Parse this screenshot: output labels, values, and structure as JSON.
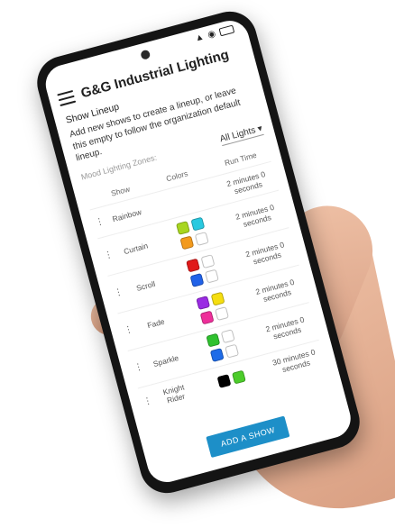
{
  "status": {
    "icons": "▲ ◉"
  },
  "app": {
    "title": "G&G Industrial Lighting"
  },
  "page": {
    "section_title": "Show Lineup",
    "description": "Add new shows to create a lineup, or leave this empty to follow the organization default lineup.",
    "zones_label": "Mood Lighting Zones:",
    "zones_select": "All Lights ▾"
  },
  "table": {
    "headers": {
      "show": "Show",
      "colors": "Colors",
      "runtime": "Run Time"
    },
    "rows": [
      {
        "name": "Rainbow",
        "colors": [],
        "runtime": "2 minutes 0 seconds"
      },
      {
        "name": "Curtain",
        "colors": [
          "#a8d620",
          "#28c9e0",
          "#f39a1d",
          "#ffffff"
        ],
        "runtime": "2 minutes 0 seconds"
      },
      {
        "name": "Scroll",
        "colors": [
          "#e01a1a",
          "#ffffff",
          "#2162e8",
          "#ffffff"
        ],
        "runtime": "2 minutes 0 seconds"
      },
      {
        "name": "Fade",
        "colors": [
          "#9a2be3",
          "#f5de10",
          "#ee2f9a",
          "#ffffff"
        ],
        "runtime": "2 minutes 0 seconds"
      },
      {
        "name": "Sparkle",
        "colors": [
          "#2fc12f",
          "#ffffff",
          "#1e6be8",
          "#ffffff"
        ],
        "runtime": "2 minutes 0 seconds"
      },
      {
        "name": "Knight Rider",
        "colors": [
          "#000000",
          "#4ccc2a"
        ],
        "runtime": "30 minutes 0 seconds"
      }
    ]
  },
  "buttons": {
    "add_show": "ADD A SHOW"
  }
}
